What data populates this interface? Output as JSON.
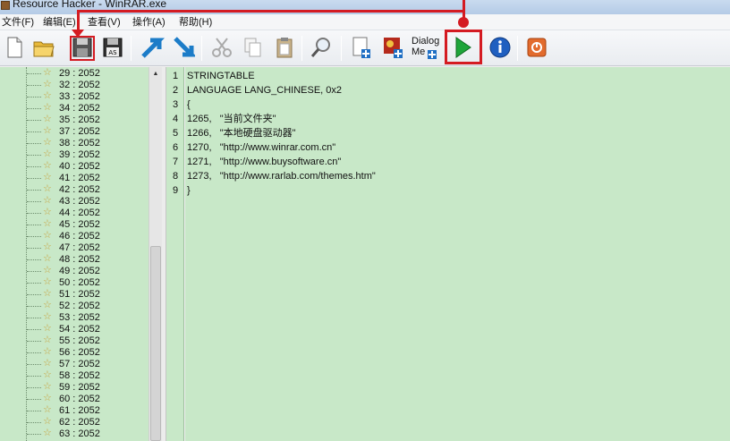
{
  "window": {
    "title": "Resource Hacker - WinRAR.exe"
  },
  "menu": [
    "文件(F)",
    "编辑(E)",
    "查看(V)",
    "操作(A)",
    "帮助(H)"
  ],
  "toolbar": {
    "dialog_label_1": "Dialog",
    "dialog_label_2": "Me"
  },
  "tree": {
    "items": [
      "29 : 2052",
      "32 : 2052",
      "33 : 2052",
      "34 : 2052",
      "35 : 2052",
      "37 : 2052",
      "38 : 2052",
      "39 : 2052",
      "40 : 2052",
      "41 : 2052",
      "42 : 2052",
      "43 : 2052",
      "44 : 2052",
      "45 : 2052",
      "46 : 2052",
      "47 : 2052",
      "48 : 2052",
      "49 : 2052",
      "50 : 2052",
      "51 : 2052",
      "52 : 2052",
      "53 : 2052",
      "54 : 2052",
      "55 : 2052",
      "56 : 2052",
      "57 : 2052",
      "58 : 2052",
      "59 : 2052",
      "60 : 2052",
      "61 : 2052",
      "62 : 2052",
      "63 : 2052"
    ]
  },
  "editor": {
    "line_numbers": [
      "1",
      "2",
      "3",
      "4",
      "5",
      "6",
      "7",
      "8",
      "9"
    ],
    "lines": [
      "STRINGTABLE",
      "LANGUAGE LANG_CHINESE, 0x2",
      "{",
      "1265,   \"当前文件夹\"",
      "1266,   \"本地硬盘驱动器\"",
      "1270,   \"http://www.winrar.com.cn\"",
      "1271,   \"http://www.buysoftware.cn\"",
      "1273,   \"http://www.rarlab.com/themes.htm\"",
      "}"
    ]
  },
  "colors": {
    "editor_bg": "#c8e8c8",
    "highlight": "#d41b22"
  }
}
